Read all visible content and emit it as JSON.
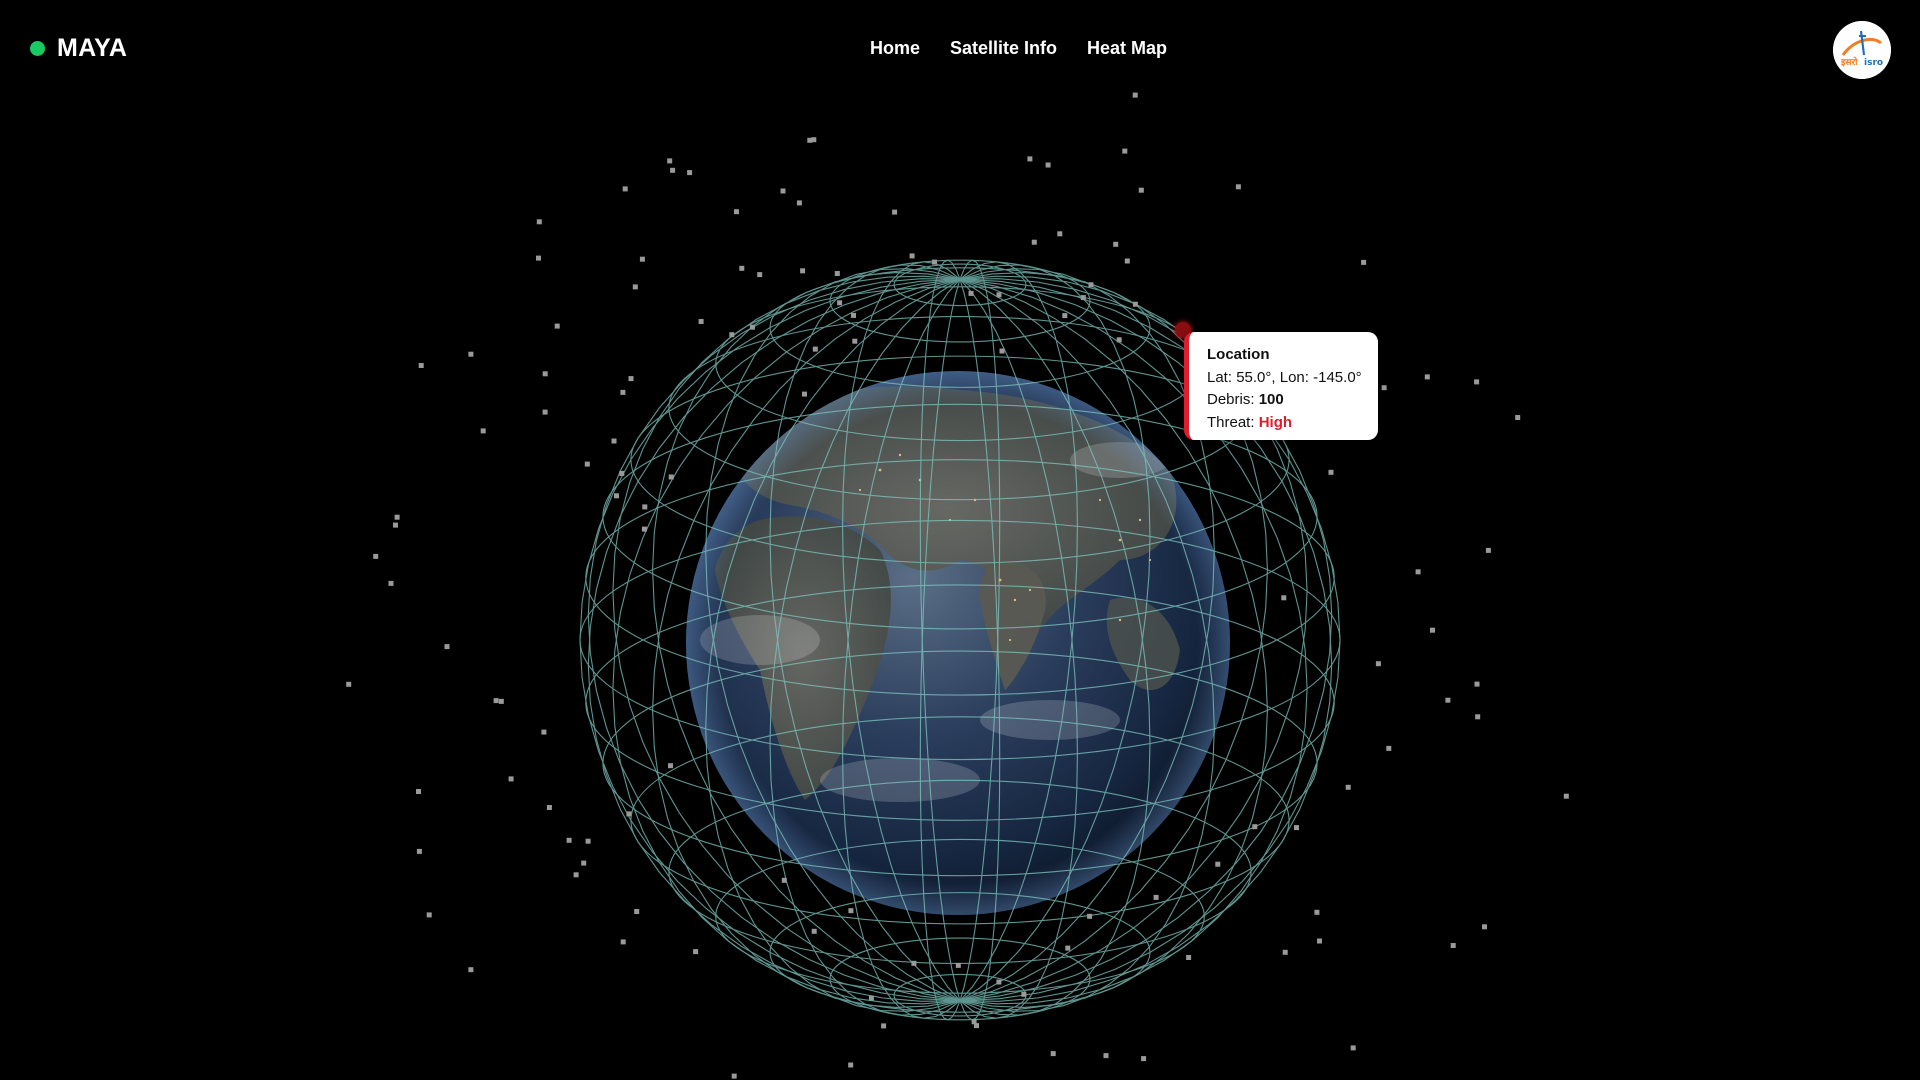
{
  "brand": {
    "name": "MAYA",
    "status_color": "#18c964"
  },
  "nav": {
    "items": [
      {
        "label": "Home"
      },
      {
        "label": "Satellite Info"
      },
      {
        "label": "Heat Map"
      }
    ]
  },
  "logo": {
    "icon": "isro-logo-icon",
    "text": "इसरो isro"
  },
  "tooltip": {
    "title": "Location",
    "lat_label": "Lat:",
    "lat_value": "55.0°",
    "lon_label": "Lon:",
    "lon_value": "-145.0°",
    "debris_label": "Debris:",
    "debris_value": "100",
    "threat_label": "Threat:",
    "threat_value": "High",
    "threat_color": "#e01d2d"
  },
  "scene": {
    "globe_icon": "earth-globe-icon",
    "grid_color": "#7fc7c0",
    "debris_color": "#9a9a9a"
  }
}
